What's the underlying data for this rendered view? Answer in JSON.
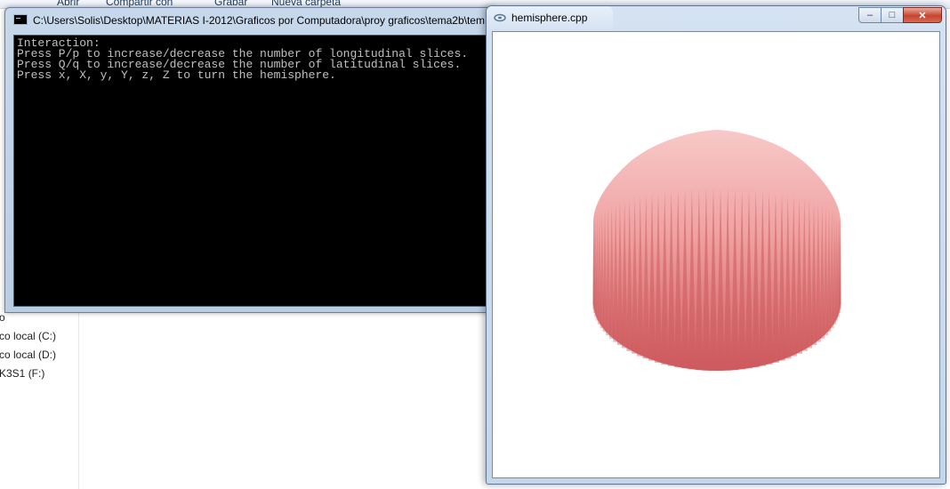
{
  "explorer": {
    "toolbar": {
      "abrir": "Abrir",
      "compartir": "Compartir con",
      "grabar": "Grabar",
      "nueva_carpeta": "Nueva carpeta"
    },
    "nav": {
      "drive_item_partial": "o",
      "drive_c": "co local (C:)",
      "drive_d": "co local (D:)",
      "drive_f": "K3S1 (F:)"
    }
  },
  "console": {
    "title": "C:\\Users\\Solis\\Desktop\\MATERIAS I-2012\\Graficos por Computadora\\proy graficos\\tema2b\\tem",
    "lines": [
      "Interaction:",
      "Press P/p to increase/decrease the number of longitudinal slices.",
      "Press Q/q to increase/decrease the number of latitudinal slices.",
      "Press x, X, y, Y, z, Z to turn the hemisphere."
    ]
  },
  "gl_window": {
    "title": "hemisphere.cpp",
    "controls": {
      "minimize": "–",
      "maximize": "□",
      "close": "✕"
    },
    "shape_colors": {
      "top": "#f7c9c8",
      "mid": "#f0a0a0",
      "bottom": "#d45c60",
      "spike_dark": "#c9595c"
    }
  }
}
